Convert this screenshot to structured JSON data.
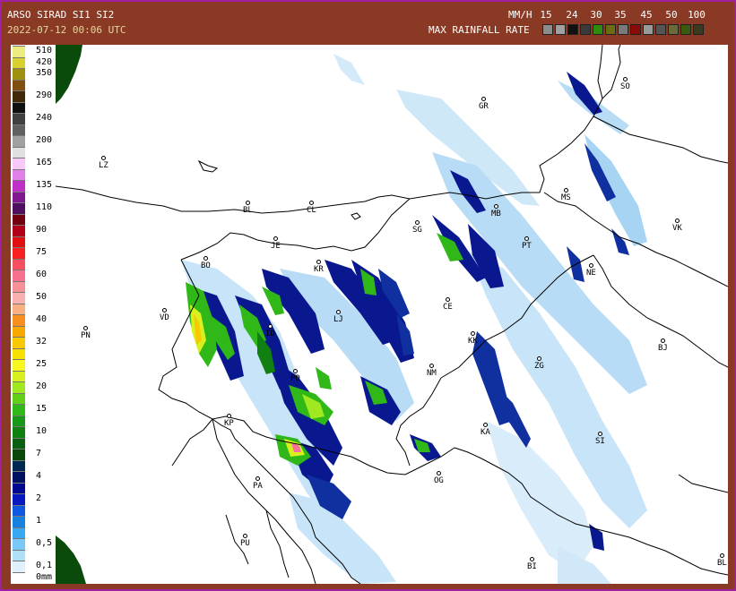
{
  "header": {
    "title": "ARSO SIRAD SI1 SI2",
    "time": "2022-07-12 00:06 UTC",
    "unit": "MM/H",
    "max_label": "MAX RAINFALL RATE",
    "scale_ticks": [
      "15",
      "24",
      "30",
      "35",
      "45",
      "50",
      "100"
    ],
    "scale_colors": [
      "#8c8c8c",
      "#a0a0a0",
      "#111111",
      "#3a3a3a",
      "#2e8b10",
      "#6b6b10",
      "#7a7a7a",
      "#8b0a0a",
      "#9a9a9a",
      "#555555",
      "#6b6b3a",
      "#3a5a10",
      "#3a3a20"
    ]
  },
  "legend": {
    "entries": [
      {
        "label": "510",
        "color": "#ecec80"
      },
      {
        "label": "420",
        "color": "#d8d030"
      },
      {
        "label": "350",
        "color": "#a09010"
      },
      {
        "label": "",
        "color": "#805010"
      },
      {
        "label": "290",
        "color": "#402808"
      },
      {
        "label": "",
        "color": "#101010"
      },
      {
        "label": "240",
        "color": "#404040"
      },
      {
        "label": "",
        "color": "#606060"
      },
      {
        "label": "200",
        "color": "#a0a0a0"
      },
      {
        "label": "",
        "color": "#e0e0e0"
      },
      {
        "label": "165",
        "color": "#f8c8f8"
      },
      {
        "label": "",
        "color": "#e080e8"
      },
      {
        "label": "135",
        "color": "#c030c8"
      },
      {
        "label": "",
        "color": "#801890"
      },
      {
        "label": "110",
        "color": "#501060"
      },
      {
        "label": "",
        "color": "#700010"
      },
      {
        "label": "90",
        "color": "#b00018"
      },
      {
        "label": "",
        "color": "#e01010"
      },
      {
        "label": "75",
        "color": "#f82020"
      },
      {
        "label": "",
        "color": "#f85060"
      },
      {
        "label": "60",
        "color": "#f87090"
      },
      {
        "label": "",
        "color": "#f89098"
      },
      {
        "label": "50",
        "color": "#f8b0b0"
      },
      {
        "label": "",
        "color": "#f8b080"
      },
      {
        "label": "40",
        "color": "#f89020"
      },
      {
        "label": "",
        "color": "#f8a800"
      },
      {
        "label": "32",
        "color": "#f8c800"
      },
      {
        "label": "",
        "color": "#f8e000"
      },
      {
        "label": "25",
        "color": "#f8f820"
      },
      {
        "label": "",
        "color": "#d8f020"
      },
      {
        "label": "20",
        "color": "#a0e820"
      },
      {
        "label": "",
        "color": "#60d018"
      },
      {
        "label": "15",
        "color": "#30b818"
      },
      {
        "label": "",
        "color": "#189818"
      },
      {
        "label": "10",
        "color": "#108010"
      },
      {
        "label": "",
        "color": "#086010"
      },
      {
        "label": "7",
        "color": "#084808"
      },
      {
        "label": "",
        "color": "#002850"
      },
      {
        "label": "4",
        "color": "#001060"
      },
      {
        "label": "",
        "color": "#000890"
      },
      {
        "label": "2",
        "color": "#0818c0"
      },
      {
        "label": "",
        "color": "#1058e0"
      },
      {
        "label": "1",
        "color": "#1880e0"
      },
      {
        "label": "",
        "color": "#38a8f0"
      },
      {
        "label": "0,5",
        "color": "#78c8f8"
      },
      {
        "label": "",
        "color": "#b0e0f8"
      },
      {
        "label": "0,1",
        "color": "#e0f0fc"
      },
      {
        "label": "0mm",
        "color": "#ffffff"
      }
    ]
  },
  "cities": [
    {
      "code": "GR"
    },
    {
      "code": "SO"
    },
    {
      "code": "LZ"
    },
    {
      "code": "BL"
    },
    {
      "code": "CL"
    },
    {
      "code": "MB"
    },
    {
      "code": "MS"
    },
    {
      "code": "VK"
    },
    {
      "code": "SG"
    },
    {
      "code": "PT"
    },
    {
      "code": "JE"
    },
    {
      "code": "BO"
    },
    {
      "code": "KR"
    },
    {
      "code": "NE"
    },
    {
      "code": "VD"
    },
    {
      "code": "LJ"
    },
    {
      "code": "CE"
    },
    {
      "code": "PN"
    },
    {
      "code": "ID"
    },
    {
      "code": "KK"
    },
    {
      "code": "BJ"
    },
    {
      "code": "NM"
    },
    {
      "code": "ZG"
    },
    {
      "code": "PO"
    },
    {
      "code": "KP"
    },
    {
      "code": "KA"
    },
    {
      "code": "SI"
    },
    {
      "code": "PA"
    },
    {
      "code": "OG"
    },
    {
      "code": "PU"
    },
    {
      "code": "BI"
    },
    {
      "code": "BL"
    }
  ]
}
